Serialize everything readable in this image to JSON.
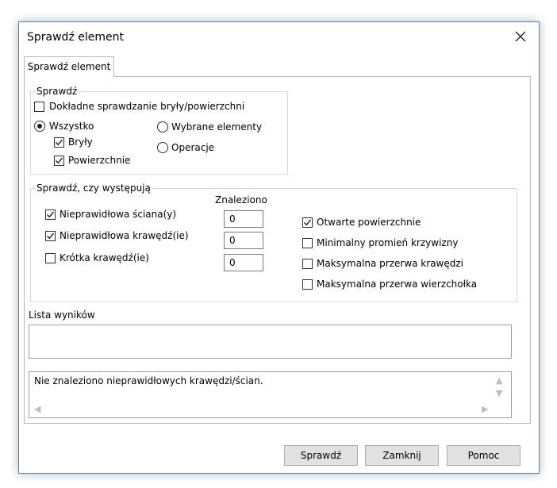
{
  "window": {
    "title": "Sprawdź element"
  },
  "tabs": [
    {
      "label": "Sprawdź element"
    }
  ],
  "check_group": {
    "legend": "Sprawdź",
    "precise": {
      "label": "Dokładne sprawdzanie bryły/powierzchni",
      "checked": false
    },
    "all": {
      "label": "Wszystko",
      "selected": true
    },
    "solids": {
      "label": "Bryły",
      "checked": true
    },
    "surfaces": {
      "label": "Powierzchnie",
      "checked": true
    },
    "selected_items": {
      "label": "Wybrane elementy",
      "selected": false
    },
    "operations": {
      "label": "Operacje",
      "selected": false
    }
  },
  "occurs_group": {
    "legend": "Sprawdź, czy występują",
    "found_header": "Znaleziono",
    "items": [
      {
        "label": "Nieprawidłowa ściana(y)",
        "checked": true,
        "count": "0"
      },
      {
        "label": "Nieprawidłowa krawędź(ie)",
        "checked": true,
        "count": "0"
      },
      {
        "label": "Krótka krawędź(ie)",
        "checked": false,
        "count": "0"
      }
    ],
    "right_items": [
      {
        "label": "Otwarte powierzchnie",
        "checked": true
      },
      {
        "label": "Minimalny promień krzywizny",
        "checked": false
      },
      {
        "label": "Maksymalna przerwa krawędzi",
        "checked": false
      },
      {
        "label": "Maksymalna przerwa wierzchołka",
        "checked": false
      }
    ]
  },
  "results": {
    "label": "Lista wyników"
  },
  "message": {
    "text": "Nie znaleziono nieprawidłowych krawędzi/ścian."
  },
  "buttons": {
    "check": "Sprawdź",
    "close": "Zamknij",
    "help": "Pomoc"
  }
}
